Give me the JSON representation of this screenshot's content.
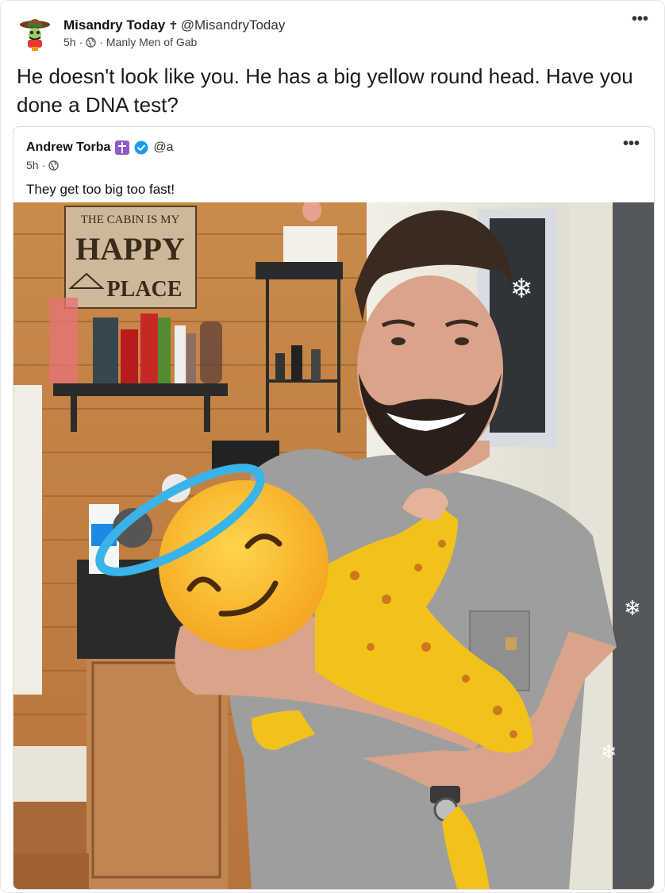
{
  "post": {
    "author_name": "Misandry Today",
    "author_cross": "✝",
    "handle": "@MisandryToday",
    "time": "5h",
    "separator": "·",
    "group": "Manly Men of Gab",
    "text": "He doesn't look like you. He has a big yellow round head. Have you done a DNA test?",
    "more_icon": "more-icon",
    "more_label": "•••"
  },
  "quote": {
    "author_name": "Andrew Torba",
    "handle": "@a",
    "time": "5h",
    "separator": "·",
    "text": "They get too big too fast!",
    "more_label": "•••",
    "badge_color": "#8e5ac8",
    "verified_color": "#1d9bf0"
  },
  "photo": {
    "sign_line1": "THE CABIN IS MY",
    "sign_line2": "HAPPY",
    "sign_line3": "PLACE"
  }
}
